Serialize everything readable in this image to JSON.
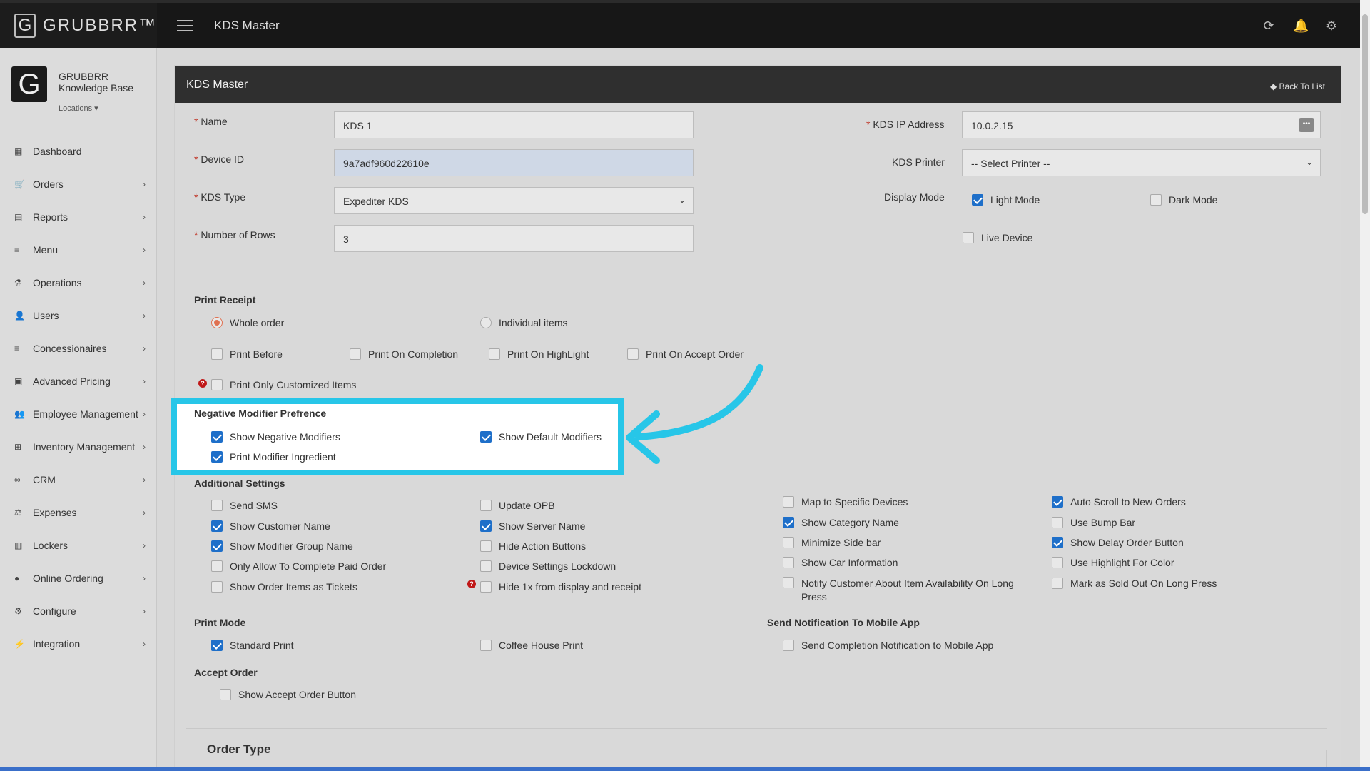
{
  "app": {
    "brand": "GRUBBRR™",
    "logo_letter": "G",
    "page_title": "KDS Master"
  },
  "sidebar": {
    "org_name": "GRUBBRR Knowledge Base",
    "locations": "Locations ▾",
    "items": [
      {
        "label": "Dashboard",
        "icon": "dashboard-icon"
      },
      {
        "label": "Orders",
        "icon": "cart-icon"
      },
      {
        "label": "Reports",
        "icon": "report-icon"
      },
      {
        "label": "Menu",
        "icon": "menu-icon"
      },
      {
        "label": "Operations",
        "icon": "flask-icon"
      },
      {
        "label": "Users",
        "icon": "users-icon"
      },
      {
        "label": "Concessionaires",
        "icon": "list-icon"
      },
      {
        "label": "Advanced Pricing",
        "icon": "money-icon"
      },
      {
        "label": "Employee Management",
        "icon": "group-icon"
      },
      {
        "label": "Inventory Management",
        "icon": "sitemap-icon"
      },
      {
        "label": "CRM",
        "icon": "link-icon"
      },
      {
        "label": "Expenses",
        "icon": "scale-icon"
      },
      {
        "label": "Lockers",
        "icon": "locker-icon"
      },
      {
        "label": "Online Ordering",
        "icon": "globe-icon"
      },
      {
        "label": "Configure",
        "icon": "gear-icon"
      },
      {
        "label": "Integration",
        "icon": "plug-icon"
      }
    ]
  },
  "panel": {
    "title": "KDS Master",
    "back": "Back To List"
  },
  "form": {
    "name_label": "Name",
    "name_value": "KDS 1",
    "device_label": "Device ID",
    "device_value": "9a7adf960d22610e",
    "kds_type_label": "KDS Type",
    "kds_type_value": "Expediter KDS",
    "rows_label": "Number of Rows",
    "rows_value": "3",
    "ip_label": "KDS IP Address",
    "ip_value": "10.0.2.15",
    "printer_label": "KDS Printer",
    "printer_value": "-- Select Printer --",
    "display_mode_label": "Display Mode",
    "light_mode": "Light Mode",
    "dark_mode": "Dark Mode",
    "live_device": "Live Device"
  },
  "print_receipt": {
    "title": "Print Receipt",
    "whole_order": "Whole order",
    "individual_items": "Individual items",
    "print_before": "Print Before",
    "print_on_completion": "Print On Completion",
    "print_on_highlight": "Print On HighLight",
    "print_on_accept": "Print On Accept Order",
    "print_only_customized": "Print Only Customized Items"
  },
  "negative_modifier": {
    "title": "Negative Modifier Prefrence",
    "show_negative": "Show Negative Modifiers",
    "show_default": "Show Default Modifiers",
    "print_ingredient": "Print Modifier Ingredient"
  },
  "additional": {
    "title": "Additional Settings",
    "col1": [
      "Send SMS",
      "Show Customer Name",
      "Show Modifier Group Name",
      "Only Allow To Complete Paid Order",
      "Show Order Items as Tickets"
    ],
    "col2": [
      "Update OPB",
      "Show Server Name",
      "Hide Action Buttons",
      "Device Settings Lockdown",
      "Hide 1x from display and receipt"
    ],
    "col3": [
      "Map to Specific Devices",
      "Show Category Name",
      "Minimize Side bar",
      "Show Car Information",
      "Notify Customer About Item Availability On Long Press"
    ],
    "col4": [
      "Auto Scroll to New Orders",
      "Use Bump Bar",
      "Show Delay Order Button",
      "Use Highlight For Color",
      "Mark as Sold Out On Long Press"
    ]
  },
  "print_mode": {
    "title": "Print Mode",
    "standard": "Standard Print",
    "coffee": "Coffee House Print"
  },
  "notification": {
    "title": "Send Notification To Mobile App",
    "completion": "Send Completion Notification to Mobile App"
  },
  "accept_order": {
    "title": "Accept Order",
    "show_button": "Show Accept Order Button"
  },
  "order_type": {
    "title": "Order Type"
  },
  "colors": {
    "highlight": "#27c6e8",
    "checkbox_on": "#1e6fc9",
    "radio_on": "#e07050"
  }
}
